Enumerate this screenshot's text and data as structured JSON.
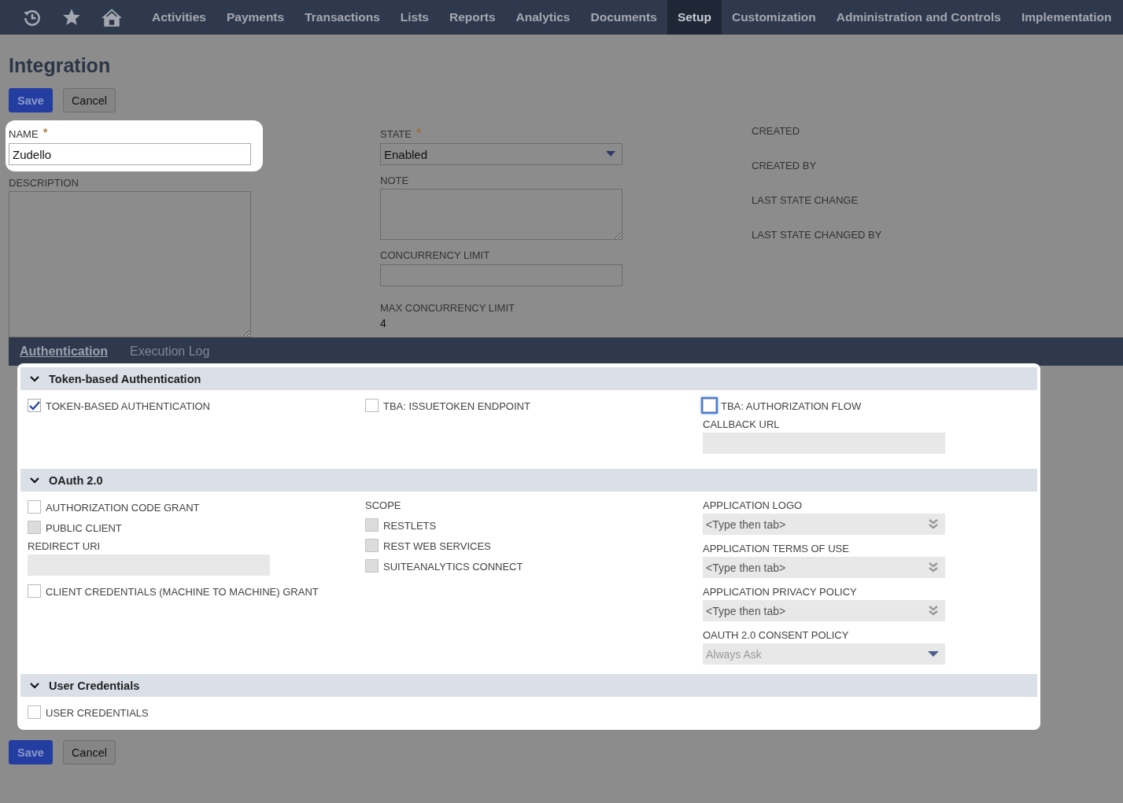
{
  "nav": {
    "items": [
      {
        "label": "Activities",
        "selected": false
      },
      {
        "label": "Payments",
        "selected": false
      },
      {
        "label": "Transactions",
        "selected": false
      },
      {
        "label": "Lists",
        "selected": false
      },
      {
        "label": "Reports",
        "selected": false
      },
      {
        "label": "Analytics",
        "selected": false
      },
      {
        "label": "Documents",
        "selected": false
      },
      {
        "label": "Setup",
        "selected": true
      },
      {
        "label": "Customization",
        "selected": false
      },
      {
        "label": "Administration and Controls",
        "selected": false
      },
      {
        "label": "Implementation",
        "selected": false
      }
    ]
  },
  "title": "Integration",
  "top_buttons": [
    {
      "label": "Save",
      "kind": "primary"
    },
    {
      "label": "Cancel",
      "kind": "secondary"
    }
  ],
  "form": {
    "name": {
      "label": "NAME",
      "required": true,
      "required_mark": "*",
      "value": "Zudello"
    },
    "description": {
      "label": "DESCRIPTION"
    },
    "state": {
      "label": "STATE",
      "required": true,
      "required_mark": "*",
      "value": "Enabled"
    },
    "note": {
      "label": "NOTE"
    },
    "concurrency_limit": {
      "label": "CONCURRENCY LIMIT"
    },
    "max_concurrency_limit": {
      "label": "MAX CONCURRENCY LIMIT",
      "value": "4"
    },
    "info_labels": [
      "CREATED",
      "CREATED BY",
      "LAST STATE CHANGE",
      "LAST STATE CHANGED BY"
    ]
  },
  "tabs": [
    {
      "label": "Authentication",
      "selected": true
    },
    {
      "label": "Execution Log",
      "selected": false
    }
  ],
  "sections": [
    {
      "title": "Token-based Authentication",
      "expanded": true,
      "columns": [
        [
          {
            "kind": "checkbox",
            "label": "TOKEN-BASED AUTHENTICATION",
            "checked": true,
            "disabled": false,
            "focused": false
          }
        ],
        [
          {
            "kind": "checkbox",
            "label": "TBA: ISSUETOKEN ENDPOINT",
            "checked": false,
            "disabled": false,
            "focused": false
          }
        ],
        [
          {
            "kind": "checkbox",
            "label": "TBA: AUTHORIZATION FLOW",
            "checked": false,
            "disabled": false,
            "focused": true
          },
          {
            "kind": "text",
            "label": "CALLBACK URL"
          }
        ]
      ]
    },
    {
      "title": "OAuth 2.0",
      "expanded": true,
      "columns": [
        [
          {
            "kind": "checkbox",
            "label": "AUTHORIZATION CODE GRANT",
            "checked": false,
            "disabled": false,
            "focused": false
          },
          {
            "kind": "checkbox",
            "label": "PUBLIC CLIENT",
            "checked": false,
            "disabled": true,
            "focused": false
          },
          {
            "kind": "text",
            "label": "REDIRECT URI"
          },
          {
            "kind": "checkbox",
            "label": "CLIENT CREDENTIALS (MACHINE TO MACHINE) GRANT",
            "checked": false,
            "disabled": false,
            "focused": false
          }
        ],
        [
          {
            "kind": "heading",
            "label": "SCOPE"
          },
          {
            "kind": "checkbox",
            "label": "RESTLETS",
            "checked": false,
            "disabled": true,
            "focused": false
          },
          {
            "kind": "checkbox",
            "label": "REST WEB SERVICES",
            "checked": false,
            "disabled": true,
            "focused": false
          },
          {
            "kind": "checkbox",
            "label": "SUITEANALYTICS CONNECT",
            "checked": false,
            "disabled": true,
            "focused": false
          }
        ],
        [
          {
            "kind": "lookup",
            "label": "APPLICATION LOGO",
            "placeholder": "<Type then tab>"
          },
          {
            "kind": "lookup",
            "label": "APPLICATION TERMS OF USE",
            "placeholder": "<Type then tab>"
          },
          {
            "kind": "lookup",
            "label": "APPLICATION PRIVACY POLICY",
            "placeholder": "<Type then tab>"
          },
          {
            "kind": "select",
            "label": "OAUTH 2.0 CONSENT POLICY",
            "value": "Always Ask"
          }
        ]
      ]
    },
    {
      "title": "User Credentials",
      "expanded": true,
      "columns": [
        [
          {
            "kind": "checkbox",
            "label": "USER CREDENTIALS",
            "checked": false,
            "disabled": false,
            "focused": false
          }
        ],
        [],
        []
      ]
    }
  ],
  "bottom_buttons": [
    {
      "label": "Save",
      "kind": "primary"
    },
    {
      "label": "Cancel",
      "kind": "secondary"
    }
  ]
}
